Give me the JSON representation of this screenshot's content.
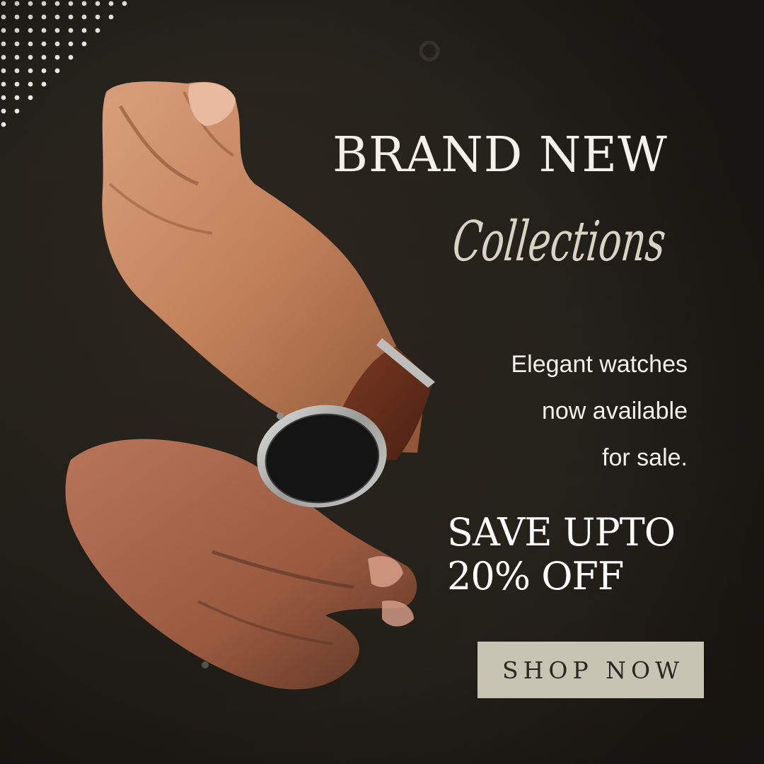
{
  "headline": {
    "line1": "BRAND NEW",
    "line2": "Collections"
  },
  "description": {
    "line1": "Elegant watches",
    "line2": "now available",
    "line3": "for sale."
  },
  "offer": {
    "line1": "SAVE UPTO",
    "line2": "20% OFF"
  },
  "cta": {
    "label": "SHOP NOW"
  },
  "colors": {
    "background": "#221f1a",
    "text": "#f4f1ea",
    "button": "#c7c4b4",
    "button_text": "#2a2720",
    "script": "#d8d3c4"
  }
}
